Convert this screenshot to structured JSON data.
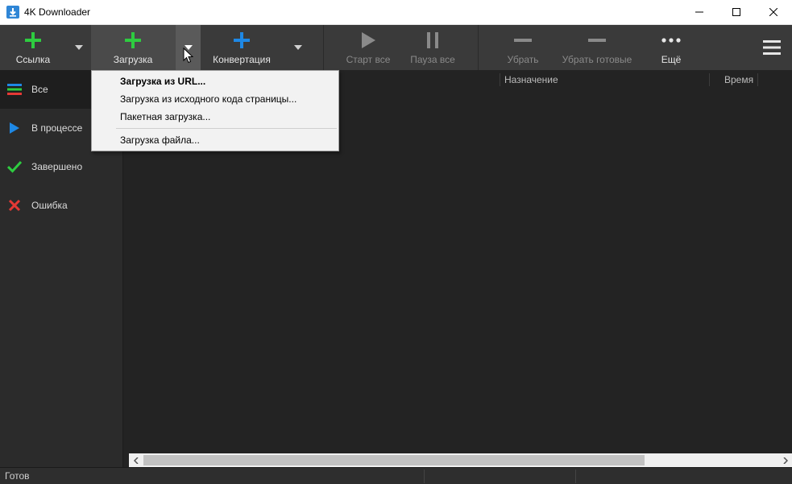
{
  "window": {
    "title": "4K Downloader",
    "icon": "app-download-icon"
  },
  "toolbar": {
    "link_label": "Ссылка",
    "download_label": "Загрузка",
    "convert_label": "Конвертация",
    "start_all_label": "Старт все",
    "pause_all_label": "Пауза все",
    "remove_label": "Убрать",
    "remove_done_label": "Убрать готовые",
    "more_label": "Ещё"
  },
  "sidebar": {
    "items": [
      {
        "label": "Все",
        "icon": "list-icon"
      },
      {
        "label": "В процессе",
        "icon": "play-icon"
      },
      {
        "label": "Завершено",
        "icon": "check-icon"
      },
      {
        "label": "Ошибка",
        "icon": "cross-icon"
      }
    ]
  },
  "table": {
    "columns": [
      "Назначение",
      "Время"
    ]
  },
  "dropdown": {
    "items": [
      "Загрузка из URL...",
      "Загрузка из исходного кода страницы...",
      "Пакетная загрузка...",
      "Загрузка файла..."
    ]
  },
  "status": {
    "text": "Готов"
  },
  "colors": {
    "green": "#2ecc40",
    "blue": "#1e88e5",
    "red": "#e53935",
    "toolbar_bg": "#3a3a3a",
    "main_bg": "#232323"
  }
}
